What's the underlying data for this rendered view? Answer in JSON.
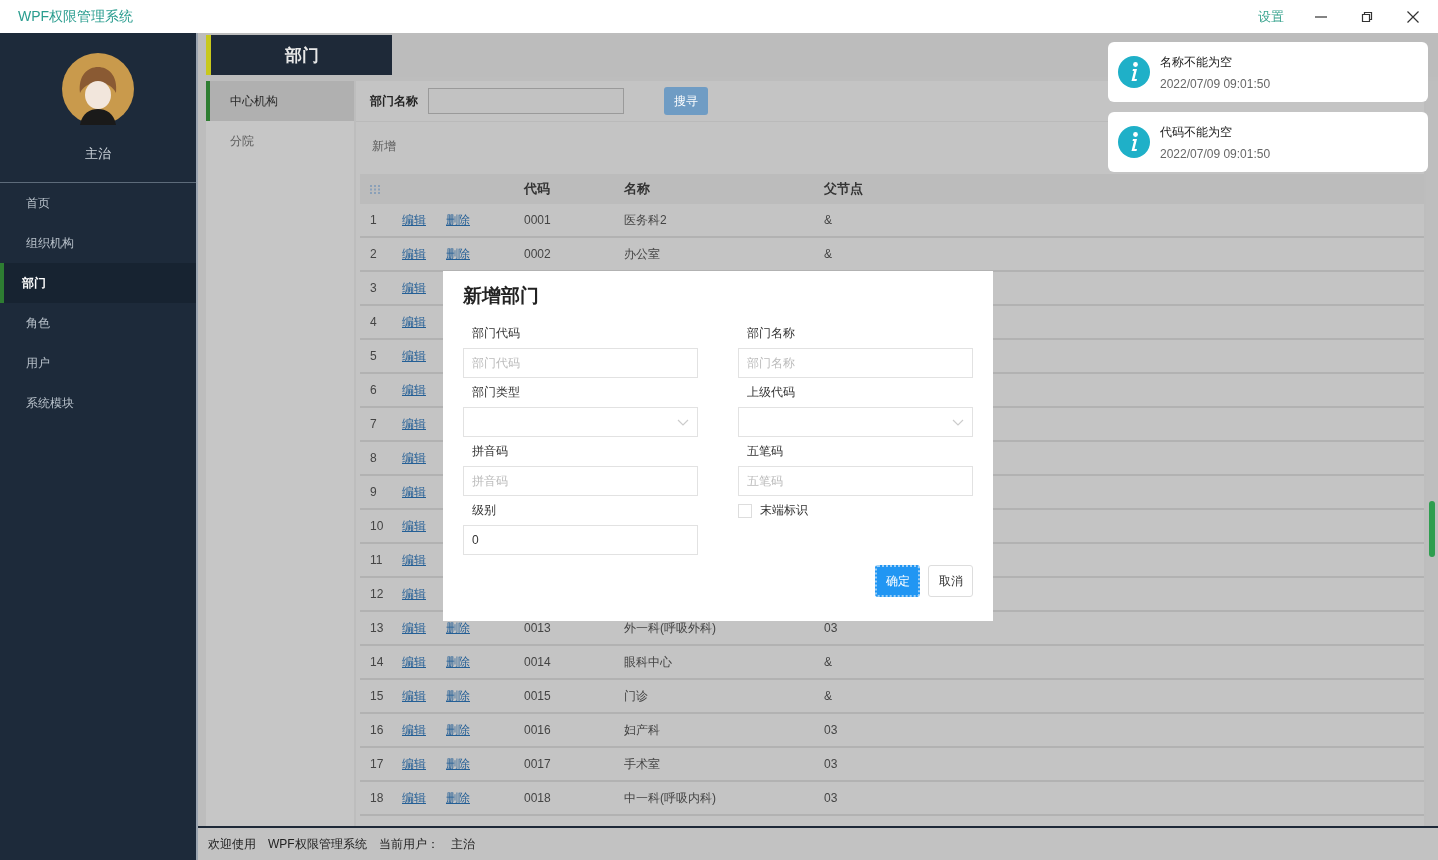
{
  "window": {
    "title": "WPF权限管理系统",
    "settings_link": "设置"
  },
  "sidebar": {
    "user_name": "主治",
    "items": [
      {
        "label": "首页",
        "selected": false
      },
      {
        "label": "组织机构",
        "selected": false
      },
      {
        "label": "部门",
        "selected": true
      },
      {
        "label": "角色",
        "selected": false
      },
      {
        "label": "用户",
        "selected": false
      },
      {
        "label": "系统模块",
        "selected": false
      }
    ]
  },
  "page_tab": "部门",
  "tree": [
    {
      "label": "中心机构",
      "selected": true
    },
    {
      "label": "分院",
      "selected": false
    }
  ],
  "search": {
    "label": "部门名称",
    "button": "搜寻"
  },
  "add_button": "新增",
  "table": {
    "columns": [
      "代码",
      "名称",
      "父节点"
    ],
    "rows": [
      {
        "index": "1",
        "edit": "编辑",
        "delete": "删除",
        "code": "0001",
        "name": "医务科2",
        "parent": "&"
      },
      {
        "index": "2",
        "edit": "编辑",
        "delete": "删除",
        "code": "0002",
        "name": "办公室",
        "parent": "&"
      },
      {
        "index": "3",
        "edit": "编辑"
      },
      {
        "index": "4",
        "edit": "编辑"
      },
      {
        "index": "5",
        "edit": "编辑"
      },
      {
        "index": "6",
        "edit": "编辑"
      },
      {
        "index": "7",
        "edit": "编辑"
      },
      {
        "index": "8",
        "edit": "编辑"
      },
      {
        "index": "9",
        "edit": "编辑"
      },
      {
        "index": "10",
        "edit": "编辑"
      },
      {
        "index": "11",
        "edit": "编辑"
      },
      {
        "index": "12",
        "edit": "编辑"
      },
      {
        "index": "13",
        "edit": "编辑",
        "delete": "删除",
        "code": "0013",
        "name": "外一科(呼吸外科)",
        "parent": "03"
      },
      {
        "index": "14",
        "edit": "编辑",
        "delete": "删除",
        "code": "0014",
        "name": "眼科中心",
        "parent": "&"
      },
      {
        "index": "15",
        "edit": "编辑",
        "delete": "删除",
        "code": "0015",
        "name": "门诊",
        "parent": "&"
      },
      {
        "index": "16",
        "edit": "编辑",
        "delete": "删除",
        "code": "0016",
        "name": "妇产科",
        "parent": "03"
      },
      {
        "index": "17",
        "edit": "编辑",
        "delete": "删除",
        "code": "0017",
        "name": "手术室",
        "parent": "03"
      },
      {
        "index": "18",
        "edit": "编辑",
        "delete": "删除",
        "code": "0018",
        "name": "中一科(呼吸内科)",
        "parent": "03"
      }
    ]
  },
  "dialog": {
    "title": "新增部门",
    "fields": [
      {
        "kind": "text",
        "label": "部门代码",
        "placeholder": "部门代码"
      },
      {
        "kind": "text",
        "label": "部门名称",
        "placeholder": "部门名称"
      },
      {
        "kind": "select",
        "label": "部门类型"
      },
      {
        "kind": "select",
        "label": "上级代码"
      },
      {
        "kind": "text",
        "label": "拼音码",
        "placeholder": "拼音码"
      },
      {
        "kind": "text",
        "label": "五笔码",
        "placeholder": "五笔码"
      },
      {
        "kind": "text",
        "label": "级别",
        "value": "0"
      },
      {
        "kind": "checkbox",
        "label": "末端标识",
        "checked": false
      }
    ],
    "buttons": [
      {
        "label": "确定",
        "kind": "primary"
      },
      {
        "label": "取消",
        "kind": "plain"
      }
    ]
  },
  "toasts": [
    {
      "message": "名称不能为空",
      "time": "2022/07/09 09:01:50"
    },
    {
      "message": "代码不能为空",
      "time": "2022/07/09 09:01:50"
    }
  ],
  "status_bar": {
    "welcome": "欢迎使用",
    "app": "WPF权限管理系统",
    "user_label": "当前用户：",
    "user": "主治"
  }
}
